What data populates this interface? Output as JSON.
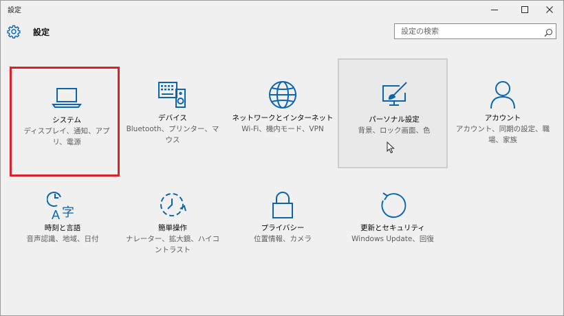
{
  "window": {
    "title": "設定",
    "minimize_label": "Minimize",
    "maximize_label": "Maximize",
    "close_label": "Close"
  },
  "header": {
    "title": "設定",
    "icon": "gear-icon"
  },
  "search": {
    "placeholder": "設定の検索",
    "value": "",
    "icon": "search-icon"
  },
  "colors": {
    "accent": "#0a64b4",
    "selection_border": "#e01e25",
    "hover_background": "#e9e9e9",
    "hover_border": "#cdcdcd",
    "window_background": "#f0f0f0",
    "description_text": "#5c5c5c"
  },
  "tiles": [
    {
      "id": "system",
      "icon": "laptop-icon",
      "label": "システム",
      "description": "ディスプレイ、通知、アプリ、電源",
      "state": "selected"
    },
    {
      "id": "devices",
      "icon": "keyboard-speaker-icon",
      "label": "デバイス",
      "description": "Bluetooth、プリンター、マウス",
      "state": "normal"
    },
    {
      "id": "network",
      "icon": "globe-icon",
      "label": "ネットワークとインターネット",
      "description": "Wi-Fi、機内モード、VPN",
      "state": "normal"
    },
    {
      "id": "personalization",
      "icon": "paintbrush-display-icon",
      "label": "パーソナル設定",
      "description": "背景、ロック画面、色",
      "state": "hovered"
    },
    {
      "id": "accounts",
      "icon": "person-icon",
      "label": "アカウント",
      "description": "アカウント、同期の設定、職場、家族",
      "state": "normal"
    },
    {
      "id": "time-language",
      "icon": "clock-language-icon",
      "label": "時刻と言語",
      "description": "音声認識、地域、日付",
      "state": "normal"
    },
    {
      "id": "ease-of-access",
      "icon": "dashed-clock-icon",
      "label": "簡単操作",
      "description": "ナレーター、拡大鏡、ハイコントラスト",
      "state": "normal"
    },
    {
      "id": "privacy",
      "icon": "padlock-icon",
      "label": "プライバシー",
      "description": "位置情報、カメラ",
      "state": "normal"
    },
    {
      "id": "update-security",
      "icon": "refresh-arrow-icon",
      "label": "更新とセキュリティ",
      "description": "Windows Update、回復",
      "state": "normal"
    }
  ]
}
